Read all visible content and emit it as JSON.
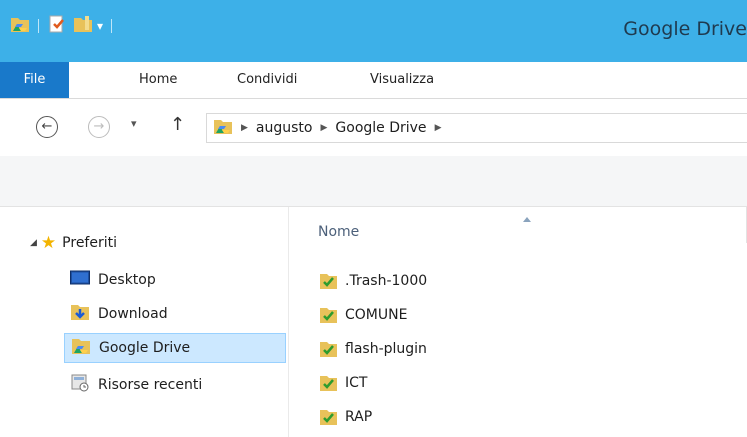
{
  "window": {
    "title": "Google Drive"
  },
  "qat_icons": [
    "google-drive-folder-icon",
    "properties-icon",
    "new-folder-icon",
    "customize-dropdown-icon"
  ],
  "ribbon": {
    "tabs": [
      {
        "label": "File"
      },
      {
        "label": "Home"
      },
      {
        "label": "Condividi"
      },
      {
        "label": "Visualizza"
      }
    ]
  },
  "address": {
    "crumbs": [
      "augusto",
      "Google Drive"
    ]
  },
  "nav": {
    "favorites_label": "Preferiti",
    "items": [
      {
        "label": "Desktop",
        "icon": "desktop-icon"
      },
      {
        "label": "Download",
        "icon": "download-folder-icon"
      },
      {
        "label": "Google Drive",
        "icon": "google-drive-folder-icon",
        "selected": true
      },
      {
        "label": "Risorse recenti",
        "icon": "recent-places-icon"
      }
    ]
  },
  "files": {
    "column_name": "Nome",
    "items": [
      {
        "name": ".Trash-1000"
      },
      {
        "name": "COMUNE"
      },
      {
        "name": "flash-plugin"
      },
      {
        "name": "ICT"
      },
      {
        "name": "RAP"
      }
    ]
  },
  "colors": {
    "titlebar": "#3db0e8",
    "file_tab": "#1979ca",
    "selection": "#cce8ff",
    "accent_folder": "#e8c25a"
  }
}
